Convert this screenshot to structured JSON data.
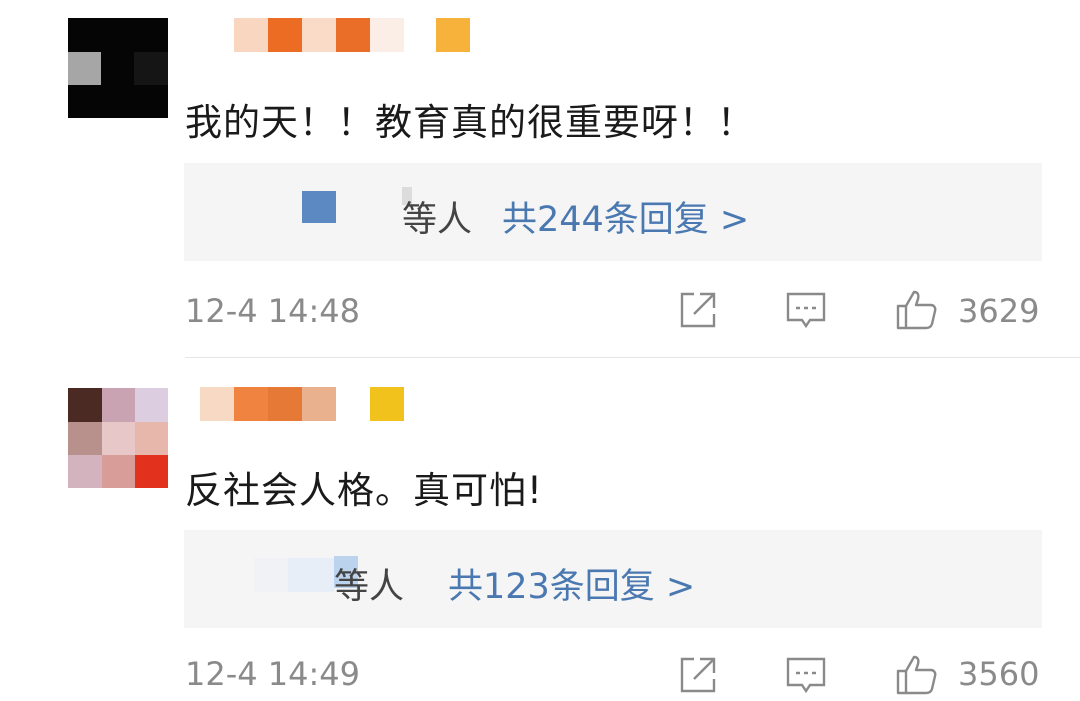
{
  "comments": [
    {
      "text": "我的天！！教育真的很重要呀！！",
      "reply_names_suffix": "等人",
      "reply_count_link": "共244条回复 >",
      "timestamp": "12-4 14:48",
      "likes": "3629"
    },
    {
      "text": "反社会人格。真可怕!",
      "reply_names_suffix": "等人",
      "reply_count_link": "共123条回复 >",
      "timestamp": "12-4 14:49",
      "likes": "3560"
    }
  ],
  "colors": {
    "reply_link": "#4a78b0",
    "meta_gray": "#8a8a8a",
    "reply_bg": "#f5f5f5"
  },
  "icons": [
    "share-icon",
    "comment-icon",
    "like-icon"
  ]
}
